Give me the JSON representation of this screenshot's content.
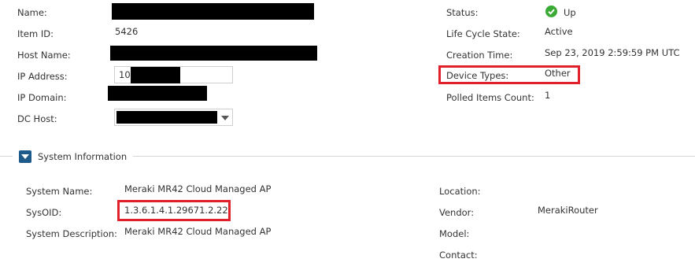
{
  "general": {
    "name_label": "Name:",
    "item_id_label": "Item ID:",
    "item_id_value": "5426",
    "host_name_label": "Host Name:",
    "ip_address_label": "IP Address:",
    "ip_address_value": "10",
    "ip_domain_label": "IP Domain:",
    "dc_host_label": "DC Host:",
    "status_label": "Status:",
    "status_value": "Up",
    "status_icon": "check-circle-icon",
    "status_color": "#3aaa35",
    "life_cycle_label": "Life Cycle State:",
    "life_cycle_value": "Active",
    "creation_time_label": "Creation Time:",
    "creation_time_value": "Sep 23, 2019 2:59:59 PM UTC",
    "device_types_label": "Device Types:",
    "device_types_value": "Other",
    "polled_items_label": "Polled Items Count:",
    "polled_items_value": "1"
  },
  "system_info": {
    "section_title": "System Information",
    "system_name_label": "System Name:",
    "system_name_value": "Meraki MR42 Cloud Managed AP",
    "sysoid_label": "SysOID:",
    "sysoid_value": "1.3.6.1.4.1.29671.2.22",
    "system_description_label": "System Description:",
    "system_description_value": "Meraki MR42 Cloud Managed AP",
    "location_label": "Location:",
    "vendor_label": "Vendor:",
    "vendor_value": "MerakiRouter",
    "model_label": "Model:",
    "contact_label": "Contact:"
  },
  "colors": {
    "highlight": "#e0202a",
    "section_button": "#1f5b8a"
  }
}
